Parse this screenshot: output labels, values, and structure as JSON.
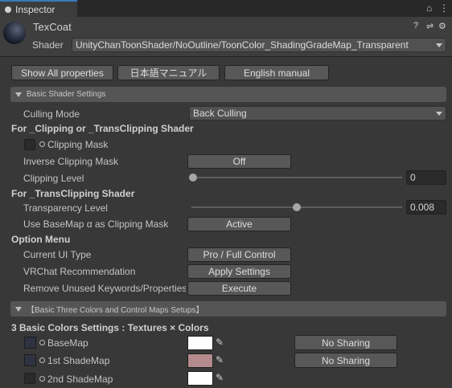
{
  "tab": {
    "title": "Inspector"
  },
  "header": {
    "material_name": "TexCoat",
    "shader_label": "Shader",
    "shader_value": "UnityChanToonShader/NoOutline/ToonColor_ShadingGradeMap_Transparent"
  },
  "top_buttons": {
    "show_all": "Show All properties",
    "jp_manual": "日本語マニュアル",
    "en_manual": "English manual"
  },
  "basic_shader_settings": {
    "title": "Basic Shader Settings",
    "culling_mode_label": "Culling Mode",
    "culling_mode_value": "Back Culling",
    "clipping_header": "For _Clipping or _TransClipping Shader",
    "clipping_mask_label": "Clipping Mask",
    "inverse_clipping_label": "Inverse Clipping Mask",
    "inverse_clipping_value": "Off",
    "clipping_level_label": "Clipping Level",
    "clipping_level_value": "0",
    "clipping_level_fraction": 0,
    "trans_clipping_header": "For _TransClipping Shader",
    "transparency_level_label": "Transparency Level",
    "transparency_level_value": "0.008",
    "transparency_level_fraction": 0.5,
    "use_basemap_alpha_label": "Use BaseMap α as Clipping Mask",
    "use_basemap_alpha_value": "Active",
    "option_menu_header": "Option Menu",
    "current_ui_type_label": "Current UI Type",
    "current_ui_type_value": "Pro / Full Control",
    "vrchat_label": "VRChat Recommendation",
    "vrchat_value": "Apply Settings",
    "remove_keywords_label": "Remove Unused Keywords/Properties",
    "remove_keywords_value": "Execute"
  },
  "three_colors": {
    "title": "【Basic Three Colors and Control Maps Setups】",
    "subheader": "3 Basic Colors Settings : Textures × Colors",
    "rows": [
      {
        "label": "BaseMap",
        "color": "#ffffff",
        "sharing": "No Sharing"
      },
      {
        "label": "1st ShadeMap",
        "color": "#b48a8c",
        "sharing": "No Sharing"
      },
      {
        "label": "2nd ShadeMap",
        "color": "#ffffff"
      }
    ]
  },
  "icons": {
    "tab": "inspector-info-icon",
    "tab_controls": [
      "lock-icon",
      "menu-icon"
    ],
    "header_controls": [
      "help-icon",
      "preset-icon",
      "gear-icon"
    ]
  }
}
